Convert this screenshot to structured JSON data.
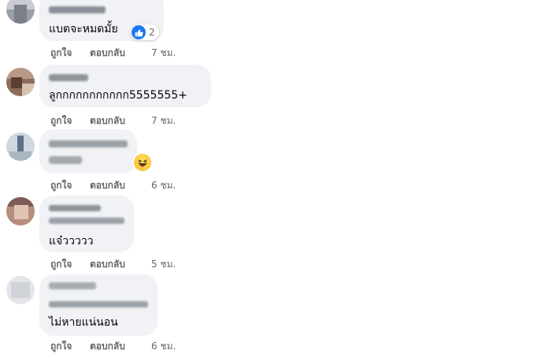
{
  "actions": {
    "like": "ถูกใจ",
    "reply": "ตอบกลับ"
  },
  "comments": [
    {
      "text": "แบตจะหมดมั้ย",
      "time": "7 ชม.",
      "reaction": {
        "type": "like",
        "count": "2"
      }
    },
    {
      "text": "ลูกกกกกกกกกกก5555555+",
      "time": "7 ชม."
    },
    {
      "text": "",
      "time": "6 ชม.",
      "reaction": {
        "type": "haha"
      }
    },
    {
      "text": "แจ๋ววววว",
      "time": "5 ชม."
    },
    {
      "text": "ไม่หายแน่นอน",
      "time": "6 ชม."
    }
  ],
  "colors": {
    "bubble": "#f0f2f5",
    "meta": "#65676b",
    "like_blue": "#1877f2"
  }
}
